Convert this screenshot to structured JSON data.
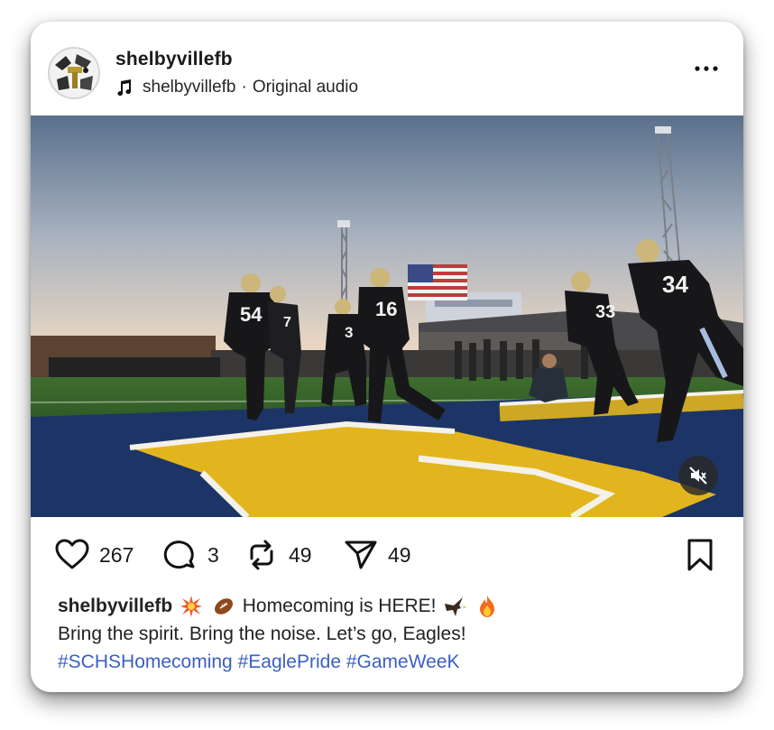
{
  "post": {
    "username": "shelbyvillefb",
    "audio_author": "shelbyvillefb",
    "audio_separator": "·",
    "audio_label": "Original audio"
  },
  "media": {
    "jersey_numbers": [
      "54",
      "7",
      "3",
      "16",
      "33",
      "34"
    ],
    "muted": true
  },
  "actions": {
    "likes": "267",
    "comments": "3",
    "reposts": "49",
    "shares": "49"
  },
  "caption": {
    "username": "shelbyvillefb",
    "line1_text": "Homecoming is HERE!",
    "line2": "Bring the spirit. Bring the noise. Let’s go, Eagles!",
    "hashtags": [
      "#SCHSHomecoming",
      "#EaglePride",
      "#GameWeeK"
    ],
    "emojis": [
      "collision-emoji",
      "football-emoji",
      "eagle-emoji",
      "fire-emoji"
    ]
  },
  "colors": {
    "hashtag": "#3b5fc4",
    "field_blue": "#1d3566",
    "endzone_gold": "#e2b51e",
    "jersey": "#17171a"
  }
}
